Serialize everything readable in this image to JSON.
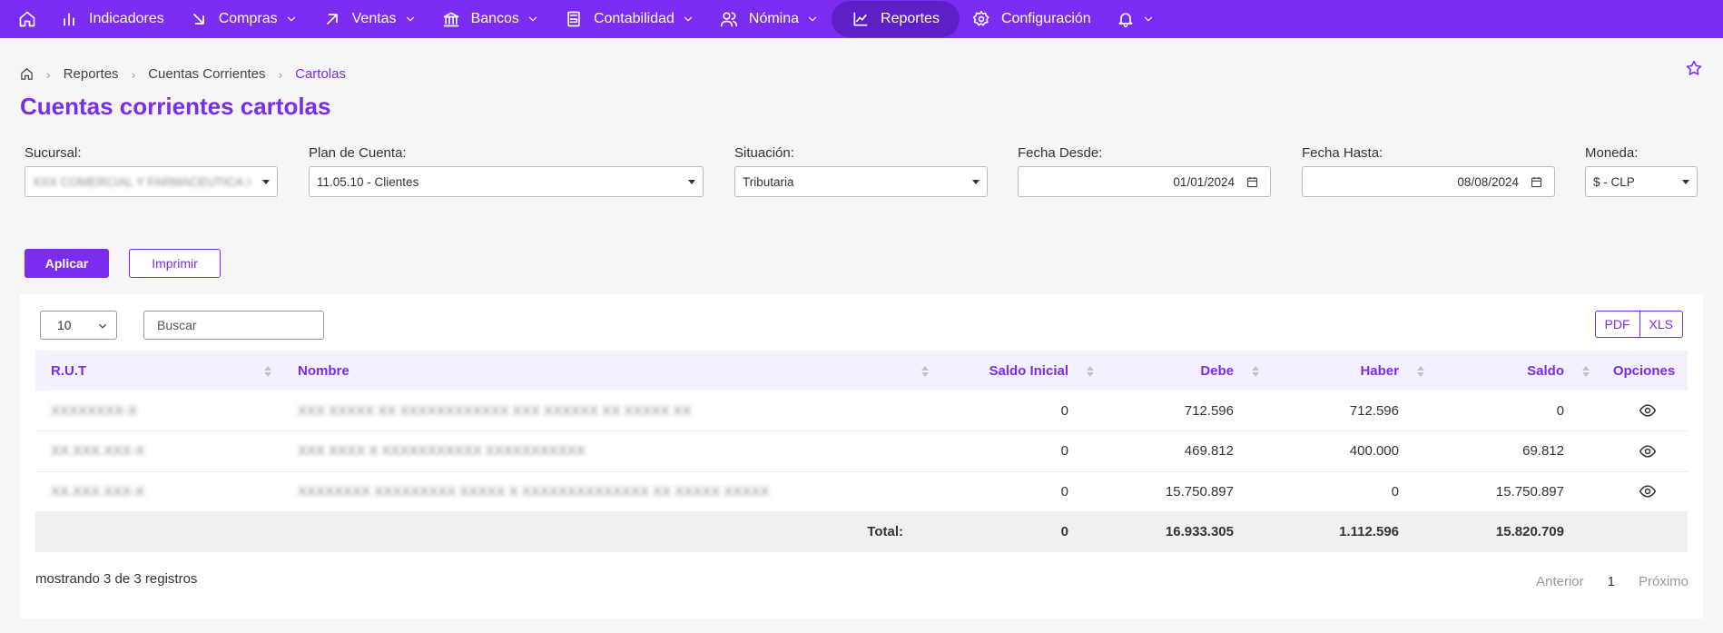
{
  "nav": {
    "items": [
      {
        "label": "Indicadores",
        "icon": "bar-chart-icon",
        "dropdown": false
      },
      {
        "label": "Compras",
        "icon": "arrow-down-right-icon",
        "dropdown": true
      },
      {
        "label": "Ventas",
        "icon": "arrow-up-right-icon",
        "dropdown": true
      },
      {
        "label": "Bancos",
        "icon": "bank-icon",
        "dropdown": true
      },
      {
        "label": "Contabilidad",
        "icon": "calculator-icon",
        "dropdown": true
      },
      {
        "label": "Nómina",
        "icon": "users-icon",
        "dropdown": true
      },
      {
        "label": "Reportes",
        "icon": "line-chart-icon",
        "dropdown": false,
        "active": true
      },
      {
        "label": "Configuración",
        "icon": "gear-icon",
        "dropdown": false
      }
    ],
    "accent": "#7a2cf0"
  },
  "breadcrumb": {
    "items": [
      "Reportes",
      "Cuentas Corrientes"
    ],
    "current": "Cartolas"
  },
  "page_title": "Cuentas corrientes cartolas",
  "filters": {
    "sucursal": {
      "label": "Sucursal:",
      "value": "XXX COMERCIAL Y FARMACEUTICA XX"
    },
    "plan_cuenta": {
      "label": "Plan de Cuenta:",
      "value": "11.05.10 - Clientes"
    },
    "situacion": {
      "label": "Situación:",
      "value": "Tributaria"
    },
    "fecha_desde": {
      "label": "Fecha Desde:",
      "value": "01/01/2024"
    },
    "fecha_hasta": {
      "label": "Fecha Hasta:",
      "value": "08/08/2024"
    },
    "moneda": {
      "label": "Moneda:",
      "value": "$ - CLP"
    }
  },
  "actions": {
    "apply": "Aplicar",
    "print": "Imprimir"
  },
  "table_controls": {
    "page_size": "10",
    "search_placeholder": "Buscar",
    "export_pdf": "PDF",
    "export_xls": "XLS"
  },
  "table": {
    "columns": [
      "R.U.T",
      "Nombre",
      "Saldo Inicial",
      "Debe",
      "Haber",
      "Saldo",
      "Opciones"
    ],
    "rows": [
      {
        "rut": "XXXXXXXX-X",
        "nombre": "XXX XXXXX XX XXXXXXXXXXXX XXX XXXXXX XX XXXXX XX",
        "saldo_inicial": "0",
        "debe": "712.596",
        "haber": "712.596",
        "saldo": "0"
      },
      {
        "rut": "XX.XXX.XXX-X",
        "nombre": "XXX XXXX X XXXXXXXXXXX XXXXXXXXXXX",
        "saldo_inicial": "0",
        "debe": "469.812",
        "haber": "400.000",
        "saldo": "69.812"
      },
      {
        "rut": "XX.XXX.XXX-X",
        "nombre": "XXXXXXXX XXXXXXXXX XXXXX X XXXXXXXXXXXXXX XX XXXXX XXXXX",
        "saldo_inicial": "0",
        "debe": "15.750.897",
        "haber": "0",
        "saldo": "15.750.897"
      }
    ],
    "total": {
      "label": "Total:",
      "saldo_inicial": "0",
      "debe": "16.933.305",
      "haber": "1.112.596",
      "saldo": "15.820.709"
    }
  },
  "footer": {
    "showing": "mostrando 3 de 3 registros",
    "prev": "Anterior",
    "page": "1",
    "next": "Próximo"
  }
}
